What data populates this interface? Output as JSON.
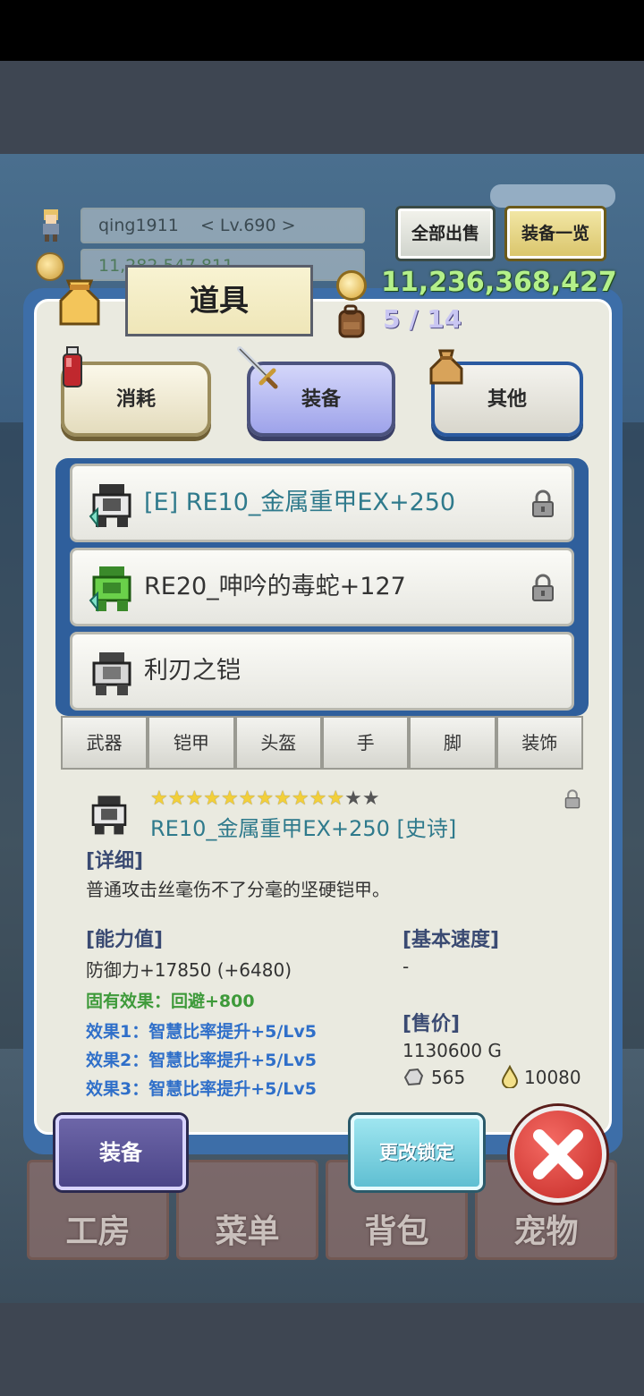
{
  "header": {
    "player_name": "qing1911",
    "level": "< Lv.690 >",
    "gold_hidden": "11,282,547,811",
    "sell_all_label": "全部出售",
    "equip_list_label": "装备一览"
  },
  "panel": {
    "title": "道具",
    "gold": "11,236,368,427",
    "slots": "5 / 14"
  },
  "categories": [
    {
      "label": "消耗"
    },
    {
      "label": "装备"
    },
    {
      "label": "其他"
    }
  ],
  "items": [
    {
      "name": "[E] RE10_金属重甲EX+250",
      "color": "#2f7a8c",
      "locked": true
    },
    {
      "name": "RE20_呻吟的毒蛇+127",
      "color": "#333333",
      "locked": true
    },
    {
      "name": "利刃之铠",
      "color": "#333333",
      "locked": false
    }
  ],
  "sub_tabs": [
    "武器",
    "铠甲",
    "头盔",
    "手",
    "脚",
    "装饰"
  ],
  "detail": {
    "stars_filled": 11,
    "stars_total": 13,
    "name": "RE10_金属重甲EX+250 [史诗]",
    "detail_label": "[详细]",
    "description": "普通攻击丝毫伤不了分毫的坚硬铠甲。",
    "ability_label": "[能力值]",
    "defense": "防御力+17850 (+6480)",
    "intrinsic": "固有效果：回避+800",
    "effects": [
      "效果1：智慧比率提升+5/Lv5",
      "效果2：智慧比率提升+5/Lv5",
      "效果3：智慧比率提升+5/Lv5"
    ],
    "speed_label": "[基本速度]",
    "speed_value": "-",
    "price_label": "[售价]",
    "price": "1130600 G",
    "ore": "565",
    "essence": "10080"
  },
  "actions": {
    "equip": "装备",
    "change_lock": "更改锁定"
  },
  "bottom_menu": [
    "工房",
    "菜单",
    "背包",
    "宠物"
  ],
  "colors": {
    "panel_blue": "#3d6ea8",
    "gold_text": "#b4f08a",
    "epic_teal": "#2f7a8c",
    "effect_blue": "#2f6fc9",
    "intrinsic_green": "#3e9a3a"
  }
}
